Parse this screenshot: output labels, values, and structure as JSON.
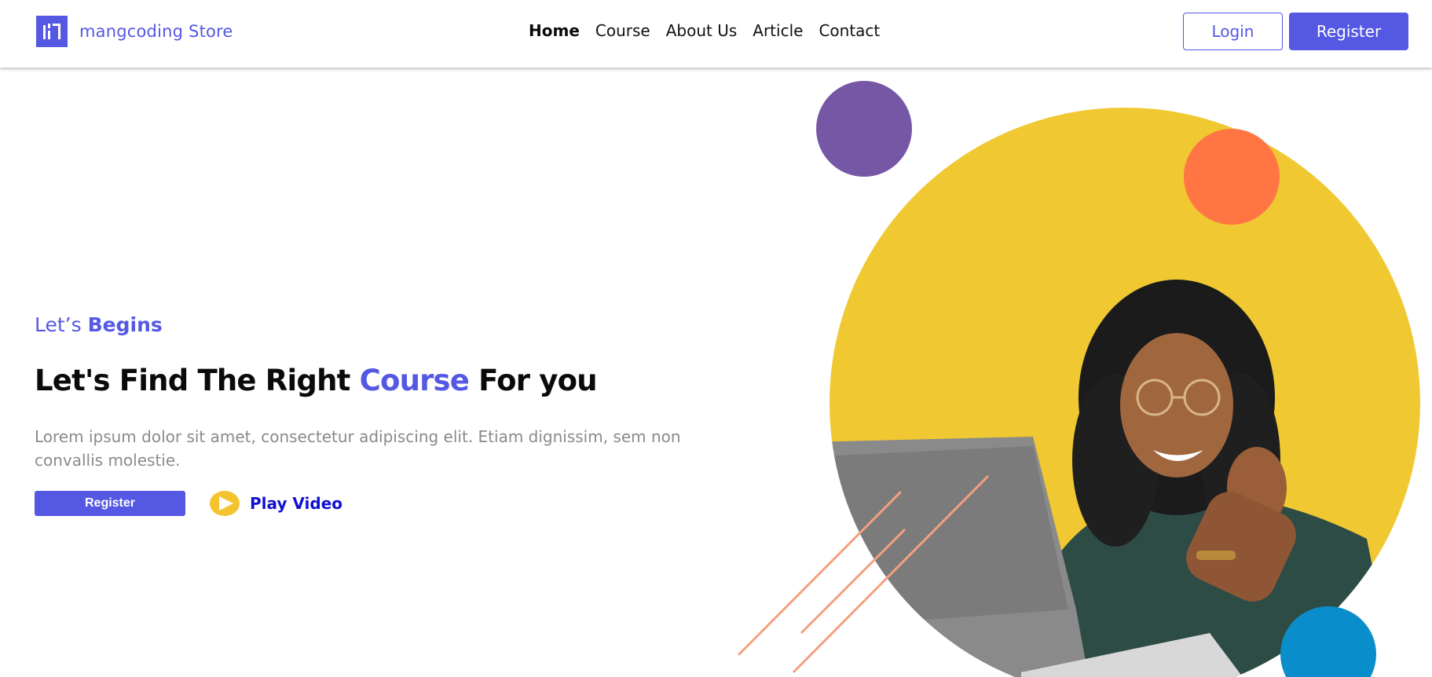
{
  "header": {
    "brand": "mangcoding Store",
    "nav": [
      {
        "label": "Home",
        "active": true
      },
      {
        "label": "Course",
        "active": false
      },
      {
        "label": "About Us",
        "active": false
      },
      {
        "label": "Article",
        "active": false
      },
      {
        "label": "Contact",
        "active": false
      }
    ],
    "login_label": "Login",
    "register_label": "Register"
  },
  "hero": {
    "eyebrow_prefix": "Let’s ",
    "eyebrow_bold": "Begins",
    "headline_start": "Let's Find The Right ",
    "headline_accent": "Course",
    "headline_end": " For you",
    "lead": "Lorem ipsum dolor sit amet, consectetur adipiscing elit. Etiam dignissim, sem non convallis molestie.",
    "register_label": "Register",
    "play_label": "Play Video"
  },
  "colors": {
    "brand": "#5458e3",
    "yellow": "#f0c832",
    "purple": "#7557a6",
    "orange": "#ff7544",
    "blue": "#0a8ecb",
    "ring": "#33a8d8"
  },
  "icons": {
    "logo": "mangcoding-logo-icon",
    "play": "play-icon"
  }
}
